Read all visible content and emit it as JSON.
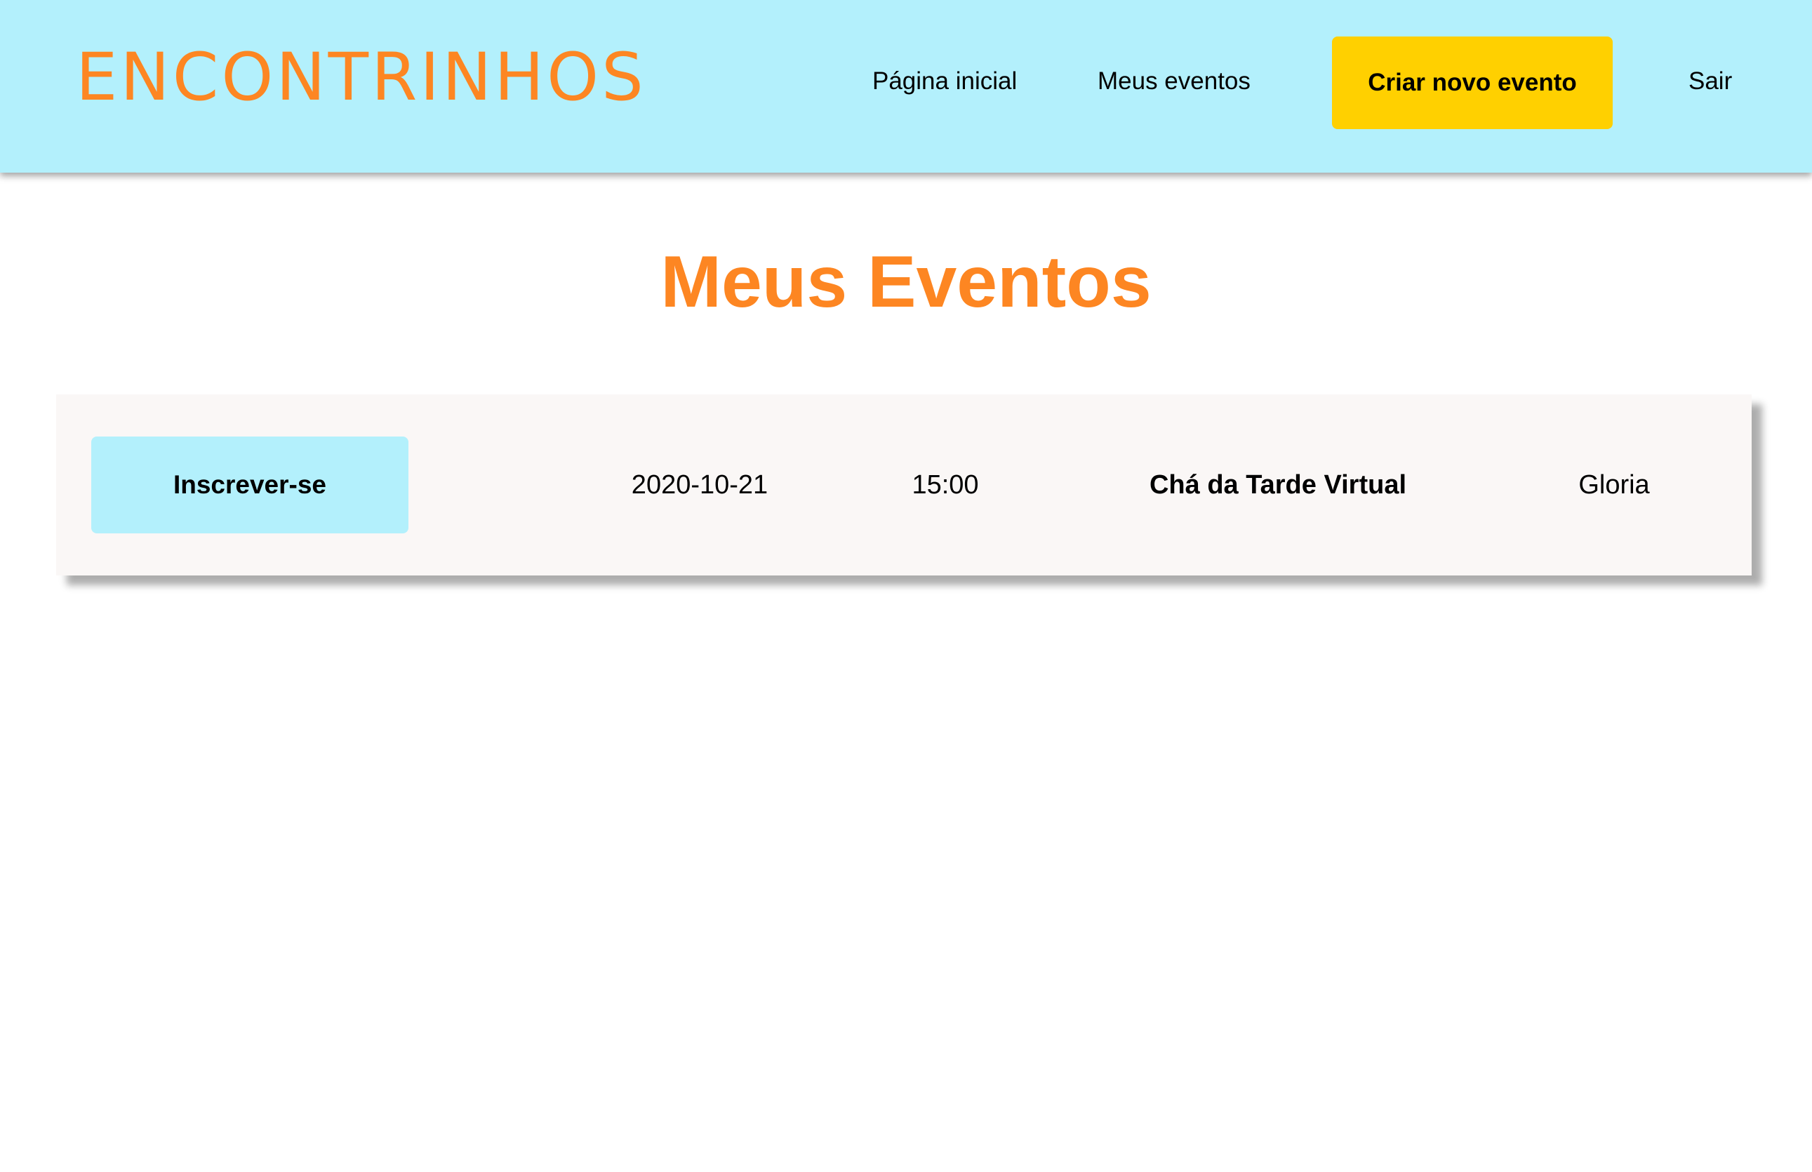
{
  "header": {
    "brand": "ENCONTRINHOS",
    "nav": {
      "home": "Página inicial",
      "my_events": "Meus eventos",
      "create_event": "Criar novo evento",
      "logout": "Sair"
    }
  },
  "main": {
    "title": "Meus Eventos",
    "events": [
      {
        "action_label": "Inscrever-se",
        "date": "2020-10-21",
        "time": "15:00",
        "name": "Chá da Tarde Virtual",
        "host": "Gloria"
      }
    ]
  },
  "colors": {
    "header_bg": "#b3f0fc",
    "brand_accent": "#fd8622",
    "primary_button": "#ffd000",
    "card_bg": "#faf7f6"
  }
}
